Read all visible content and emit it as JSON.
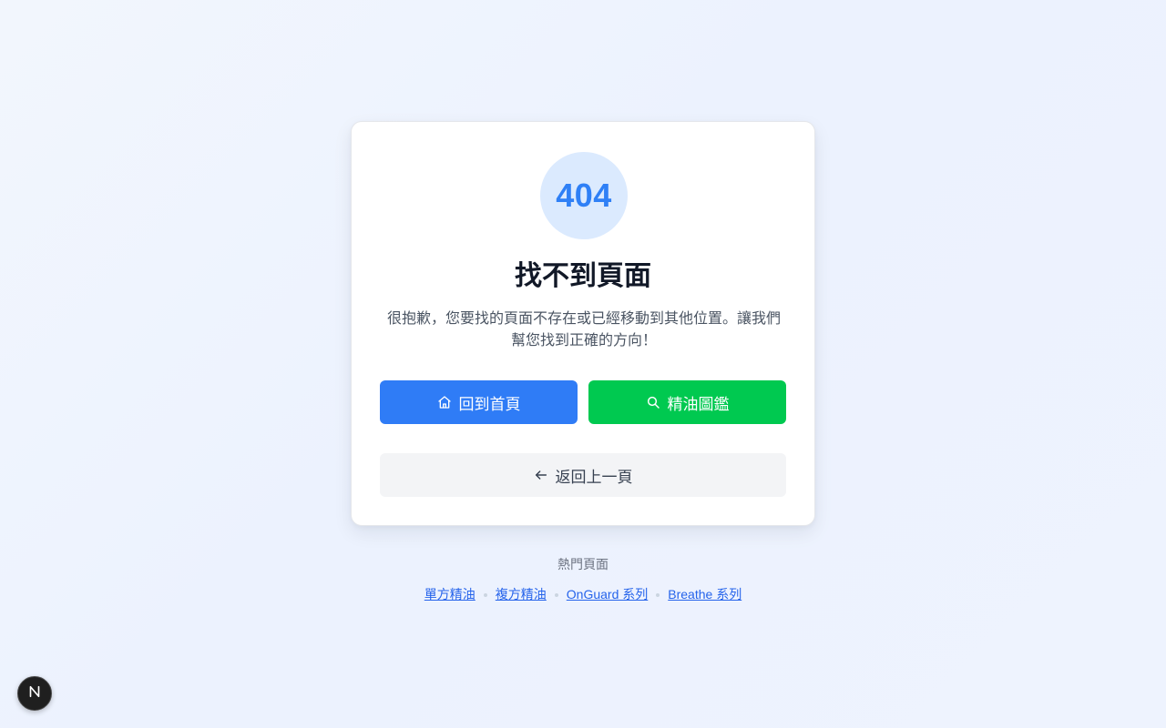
{
  "error": {
    "code": "404",
    "title": "找不到頁面",
    "description": "很抱歉，您要找的頁面不存在或已經移動到其他位置。讓我們幫您找到正確的方向！"
  },
  "actions": {
    "home": {
      "label": "回到首頁",
      "icon": "home-icon",
      "color": "#2f7cf6"
    },
    "guide": {
      "label": "精油圖鑑",
      "icon": "search-icon",
      "color": "#00c950"
    },
    "back": {
      "label": "返回上一頁",
      "icon": "arrow-left-icon",
      "color": "#f3f4f6"
    }
  },
  "popular": {
    "title": "熱門頁面",
    "links": [
      "單方精油",
      "複方精油",
      "OnGuard 系列",
      "Breathe 系列"
    ]
  },
  "dev_badge": {
    "icon": "nextjs-logo-icon",
    "letter": "N"
  }
}
